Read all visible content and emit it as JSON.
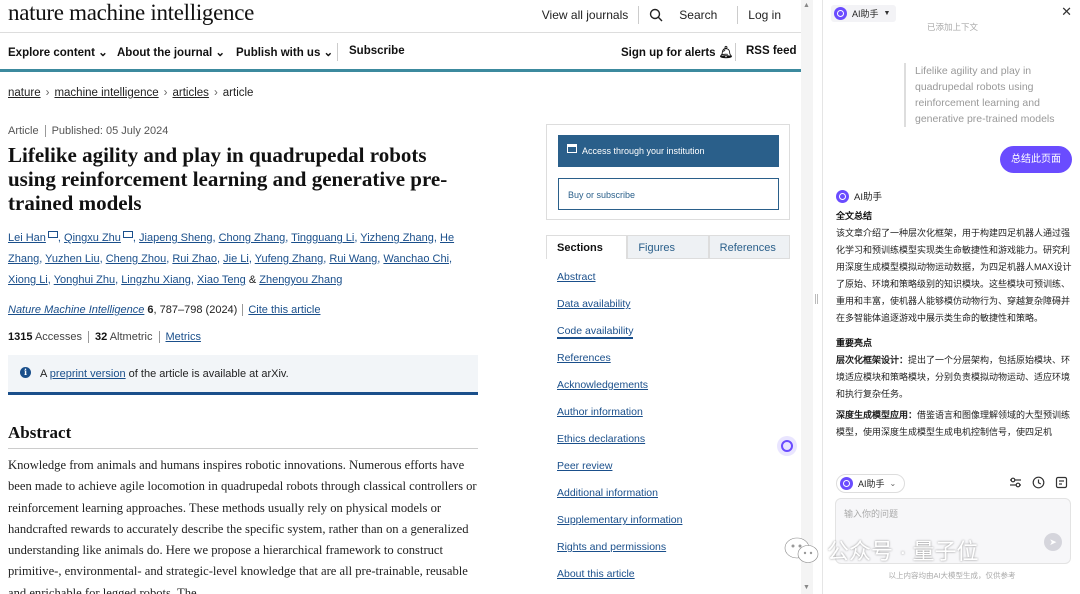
{
  "header": {
    "logo": "nature machine intelligence",
    "view_all": "View all journals",
    "search": "Search",
    "login": "Log in"
  },
  "nav": {
    "explore": "Explore content",
    "about": "About the journal",
    "publish": "Publish with us",
    "subscribe": "Subscribe",
    "alerts": "Sign up for alerts",
    "rss": "RSS feed"
  },
  "breadcrumb": [
    "nature",
    "machine intelligence",
    "articles",
    "article"
  ],
  "article": {
    "type": "Article",
    "published": "Published: 05 July 2024",
    "title": "Lifelike agility and play in quadrupedal robots using reinforcement learning and generative pre-trained models",
    "authors": [
      "Lei Han",
      "Qingxu Zhu",
      "Jiapeng Sheng",
      "Chong Zhang",
      "Tingguang Li",
      "Yizheng Zhang",
      "He Zhang",
      "Yuzhen Liu",
      "Cheng Zhou",
      "Rui Zhao",
      "Jie Li",
      "Yufeng Zhang",
      "Rui Wang",
      "Wanchao Chi",
      "Xiong Li",
      "Yonghui Zhu",
      "Lingzhu Xiang",
      "Xiao Teng",
      "Zhengyou Zhang"
    ],
    "journal": "Nature Machine Intelligence",
    "volume": "6",
    "pages": ", 787–798 (2024)",
    "cite": "Cite this article",
    "accesses_num": "1315",
    "accesses_label": "Accesses",
    "altmetric_num": "32",
    "altmetric_label": "Altmetric",
    "metrics": "Metrics",
    "info_prefix": "A ",
    "info_link": "preprint version",
    "info_suffix": " of the article is available at arXiv.",
    "abstract_heading": "Abstract",
    "abstract_text": "Knowledge from animals and humans inspires robotic innovations. Numerous efforts have been made to achieve agile locomotion in quadrupedal robots through classical controllers or reinforcement learning approaches. These methods usually rely on physical models or handcrafted rewards to accurately describe the specific system, rather than on a generalized understanding like animals do. Here we propose a hierarchical framework to construct primitive-, environmental- and strategic-level knowledge that are all pre-trainable, reusable and enrichable for legged robots. The"
  },
  "sidebar": {
    "access": "Access through your institution",
    "buy": "Buy or subscribe",
    "tabs": [
      "Sections",
      "Figures",
      "References"
    ],
    "sections": [
      "Abstract",
      "Data availability",
      "Code availability",
      "References",
      "Acknowledgements",
      "Author information",
      "Ethics declarations",
      "Peer review",
      "Additional information",
      "Supplementary information",
      "Rights and permissions",
      "About this article"
    ]
  },
  "ai": {
    "name": "AI助手",
    "faded": "已添加上下文",
    "quote": "Lifelike agility and play in quadrupedal robots using reinforcement learning and generative pre-trained models",
    "summarize": "总结此页面",
    "assistant_label": "AI助手",
    "summary_heading": "全文总结",
    "summary_text": "该文章介绍了一种层次化框架，用于构建四足机器人通过强化学习和预训练模型实现类生命敏捷性和游戏能力。研究利用深度生成模型模拟动物运动数据，为四足机器人MAX设计了原始、环境和策略级别的知识模块。这些模块可预训练、重用和丰富，使机器人能够模仿动物行为、穿越复杂障碍并在多智能体追逐游戏中展示类生命的敏捷性和策略。",
    "highlights_heading": "重要亮点",
    "h1_title": "层次化框架设计：",
    "h1_text": "提出了一个分层架构，包括原始模块、环境适应模块和策略模块，分别负责模拟动物运动、适应环境和执行复杂任务。",
    "h2_title": "深度生成模型应用：",
    "h2_text": "借鉴语言和图像理解领域的大型预训练模型，使用深度生成模型生成电机控制信号，使四足机",
    "model_label": "AI助手",
    "input_placeholder": "输入你的问题",
    "disclaimer": "以上内容均由AI大模型生成，仅供参考"
  },
  "watermark": {
    "text": "公众号 · 量子位"
  },
  "colors": {
    "brand_teal": "#3c8a9e",
    "link_blue": "#1a4f8b",
    "access_button": "#2a5f8a",
    "ai_purple": "#6a4cff"
  }
}
